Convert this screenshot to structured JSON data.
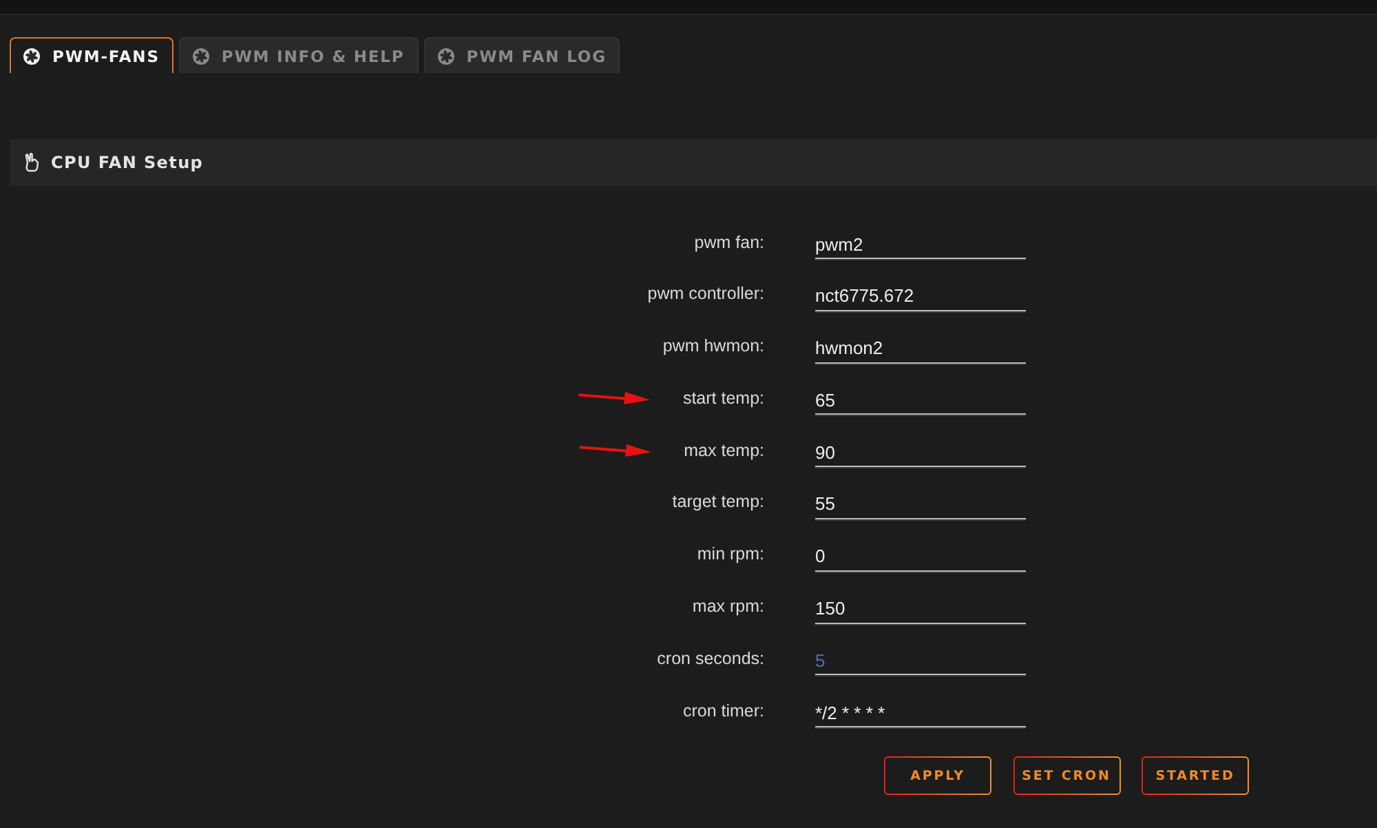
{
  "tabs": [
    {
      "label": "PWM-FANS",
      "selected": true
    },
    {
      "label": "PWM INFO & HELP",
      "selected": false
    },
    {
      "label": "PWM FAN LOG",
      "selected": false
    }
  ],
  "section": {
    "title": "CPU FAN Setup"
  },
  "fields": [
    {
      "label": "pwm fan:",
      "value": "pwm2",
      "arrow": false
    },
    {
      "label": "pwm controller:",
      "value": "nct6775.672",
      "arrow": false
    },
    {
      "label": "pwm hwmon:",
      "value": "hwmon2",
      "arrow": false
    },
    {
      "label": "start temp:",
      "value": "65",
      "arrow": true
    },
    {
      "label": "max temp:",
      "value": "90",
      "arrow": true
    },
    {
      "label": "target temp:",
      "value": "55",
      "arrow": false
    },
    {
      "label": "min rpm:",
      "value": "0",
      "arrow": false
    },
    {
      "label": "max rpm:",
      "value": "150",
      "arrow": false
    },
    {
      "label": "cron seconds:",
      "placeholder": "5",
      "arrow": false
    },
    {
      "label": "cron timer:",
      "value": "*/2 * * * *",
      "arrow": false
    }
  ],
  "buttons": [
    "APPLY",
    "SET CRON",
    "STARTED"
  ]
}
